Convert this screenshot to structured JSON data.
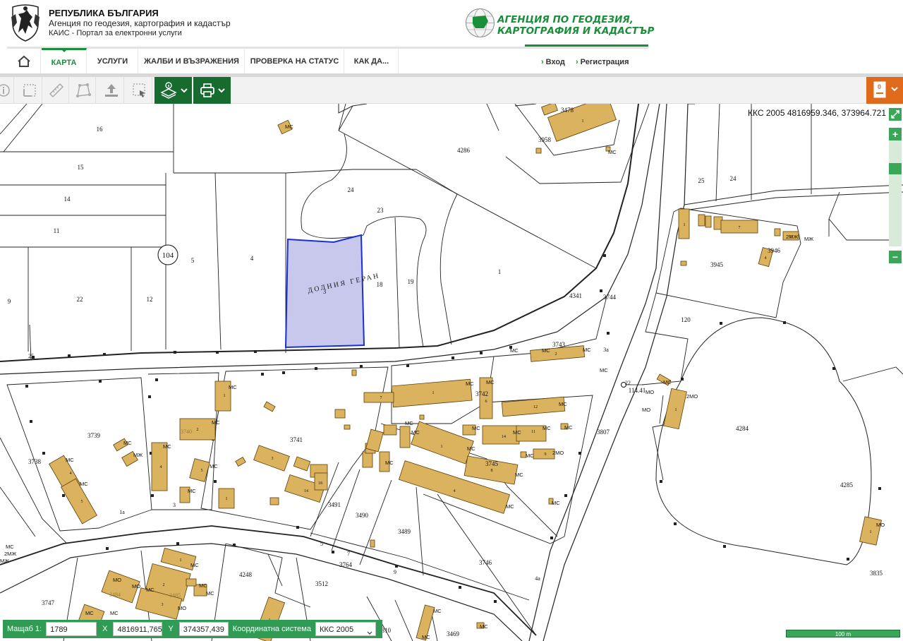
{
  "header": {
    "title": "РЕПУБЛИКА БЪЛГАРИЯ",
    "subtitle": "Агенция по геодезия, картография и кадастър",
    "portal": "КАИС - Портал за електронни услуги",
    "agency_line1": "АГЕНЦИЯ ПО ГЕОДЕЗИЯ,",
    "agency_line2": "КАРТОГРАФИЯ И КАДАСТЪР",
    "brand_color": "#1a8f3a"
  },
  "nav": {
    "home_icon": "home-icon",
    "items": [
      "КАРТА",
      "УСЛУГИ",
      "ЖАЛБИ И ВЪЗРАЖЕНИЯ",
      "ПРОВЕРКА НА СТАТУС",
      "КАК ДА..."
    ],
    "active_index": 0,
    "login": "Вход",
    "register": "Регистрация"
  },
  "toolbar": {
    "tools": [
      "info-icon",
      "measure-area-icon",
      "ruler-icon",
      "polygon-icon",
      "upload-icon",
      "select-area-icon"
    ],
    "layers_icon": "layers-icon",
    "print_icon": "print-icon",
    "cart_count": "0",
    "accent": "#176b2e",
    "cart_color": "#e06a1c"
  },
  "map": {
    "coordinates": "ККС 2005 4816959.346, 373964.721",
    "locality": "ДОЛНИЯ ГЕРАН",
    "region_marker": "104",
    "selected_parcel": "3",
    "parcels": [
      "16",
      "15",
      "14",
      "11",
      "9",
      "22",
      "12",
      "5",
      "4",
      "24",
      "23",
      "18",
      "19",
      "1",
      "4286",
      "3478",
      "3958",
      "25",
      "24",
      "3945",
      "3946",
      "4341",
      "3744",
      "3743",
      "120",
      "3739",
      "3738",
      "3740",
      "3741",
      "3742",
      "3745",
      "3491",
      "3490",
      "3489",
      "3746",
      "3807",
      "4284",
      "4285",
      "3764",
      "4248",
      "3512",
      "3747",
      "3484",
      "3835",
      "3469",
      "3810",
      "114.41"
    ],
    "building_labels": [
      "МС",
      "МЖ",
      "МО",
      "2МО",
      "2МЖ"
    ]
  },
  "zoom": {
    "in": "+",
    "out": "−",
    "fullscreen_icon": "fullscreen-icon"
  },
  "status": {
    "scale_label": "Мащаб  1:",
    "scale_value": "1789",
    "x_label": "X",
    "x_value": "4816911,765",
    "y_label": "Y",
    "y_value": "374357,439",
    "cs_label": "Координатна система",
    "cs_value": "ККС 2005"
  },
  "scalebar": "100 m"
}
